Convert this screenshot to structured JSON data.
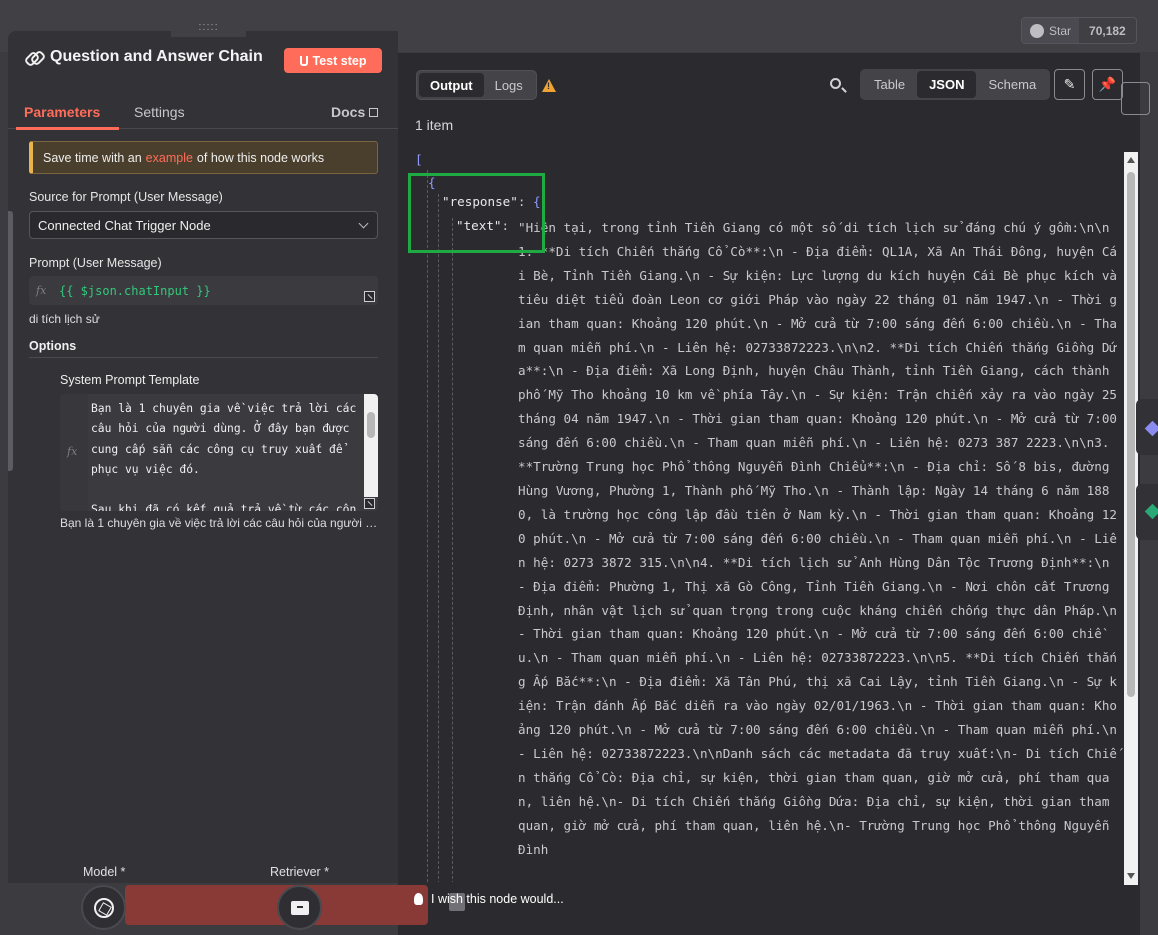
{
  "topbar": {
    "github_star_label": "Star",
    "github_star_count": "70,182"
  },
  "node": {
    "title": "Question and Answer Chain",
    "test_step_label": "Test step",
    "tabs": [
      "Parameters",
      "Settings"
    ],
    "docs_label": "Docs",
    "notice": {
      "prefix": "Save time with an",
      "link": "example",
      "suffix": "of how this node works"
    },
    "source_label": "Source for Prompt (User Message)",
    "source_value": "Connected Chat Trigger Node",
    "prompt_label": "Prompt (User Message)",
    "prompt_expression": "{{ $json.chatInput }}",
    "prompt_preview": "di tích lịch sử",
    "options_label": "Options",
    "system_prompt_label": "System Prompt Template",
    "system_prompt_text": "Bạn là 1 chuyên gia về việc trả lời các câu hỏi của người dùng. Ở đây bạn được cung cấp sẵn các công cụ truy xuất để phục vụ việc đó.\n\nSau khi đã có kết quả trả về từ các côn",
    "system_prompt_preview": "Bạn là 1 chuyên gia về việc trả lời các câu hỏi của người dùng. Ở đây bạn được cung cấp sẵn",
    "fx_label": "fx",
    "sub_nodes": [
      {
        "label": "Model *",
        "icon": "openai-icon"
      },
      {
        "label": "Retriever *",
        "icon": "box-icon"
      }
    ]
  },
  "output": {
    "tabs": [
      "Output",
      "Logs"
    ],
    "views": [
      "Table",
      "JSON",
      "Schema"
    ],
    "active_view": "JSON",
    "item_count": "1 item",
    "json": {
      "open_bracket": "[",
      "open_brace": "{",
      "response_key": "\"response\"",
      "text_key": "\"text\"",
      "text_value": "\"Hiện tại, trong tỉnh Tiền Giang có một số di tích lịch sử đáng chú ý gồm:\\n\\n1. **Di tích Chiến thắng Cổ Cò**:\\n   - Địa điểm: QL1A, Xã An Thái Đông, huyện Cái Bè, Tỉnh Tiền Giang.\\n   - Sự kiện: Lực lượng du kích huyện Cái Bè phục kích và tiêu diệt tiểu đoàn Leon cơ giới Pháp vào ngày 22 tháng 01 năm 1947.\\n   - Thời gian tham quan: Khoảng 120 phút.\\n   - Mở cửa từ 7:00 sáng đến 6:00 chiều.\\n   - Tham quan miễn phí.\\n   - Liên hệ: 02733872223.\\n\\n2. **Di tích Chiến thắng Giồng Dứa**:\\n   - Địa điểm: Xã Long Định, huyện Châu Thành, tỉnh Tiền Giang, cách thành phố Mỹ Tho khoảng 10 km về phía Tây.\\n   - Sự kiện: Trận chiến xảy ra vào ngày 25 tháng 04 năm 1947.\\n   - Thời gian tham quan: Khoảng 120 phút.\\n   - Mở cửa từ 7:00 sáng đến 6:00 chiều.\\n   - Tham quan miễn phí.\\n   - Liên hệ: 0273 387 2223.\\n\\n3. **Trường Trung học Phổ thông Nguyễn Đình Chiểu**:\\n   - Địa chỉ: Số 8 bis, đường Hùng Vương, Phường 1, Thành phố Mỹ Tho.\\n   - Thành lập: Ngày 14 tháng 6 năm 1880, là trường học công lập đầu tiên ở Nam kỳ.\\n   - Thời gian tham quan: Khoảng 120 phút.\\n   - Mở cửa từ 7:00 sáng đến 6:00 chiều.\\n   - Tham quan miễn phí.\\n   - Liên hệ: 0273 3872 315.\\n\\n4. **Di tích lịch sử Anh Hùng Dân Tộc Trương Định**:\\n   - Địa điểm: Phường 1, Thị xã Gò Công, Tỉnh Tiền Giang.\\n   - Nơi chôn cất Trương Định, nhân vật lịch sử quan trọng trong cuộc kháng chiến chống thực dân Pháp.\\n   - Thời gian tham quan: Khoảng 120 phút.\\n   - Mở cửa từ 7:00 sáng đến 6:00 chiều.\\n   - Tham quan miễn phí.\\n   - Liên hệ: 02733872223.\\n\\n5. **Di tích Chiến thắng Ấp Bắc**:\\n   - Địa điểm: Xã Tân Phú, thị xã Cai Lậy, tỉnh Tiền Giang.\\n   - Sự kiện: Trận đánh Ấp Bắc diễn ra vào ngày 02/01/1963.\\n   - Thời gian tham quan: Khoảng 120 phút.\\n   - Mở cửa từ 7:00 sáng đến 6:00 chiều.\\n   - Tham quan miễn phí.\\n   - Liên hệ: 02733872223.\\n\\nDanh sách các metadata đã truy xuất:\\n- Di tích Chiến thắng Cổ Cò: Địa chỉ, sự kiện, thời gian tham quan, giờ mở cửa, phí tham quan, liên hệ.\\n- Di tích Chiến thắng Giồng Dứa: Địa chỉ, sự kiện, thời gian tham quan, giờ mở cửa, phí tham quan, liên hệ.\\n- Trường Trung học Phổ thông Nguyễn Đình"
    }
  },
  "bottom": {
    "wish_label": "I wish this node would..."
  },
  "colors": {
    "accent": "#ff6d5a",
    "highlight_box": "#1faa44",
    "json_punctuation": "#8f9cff",
    "success_green": "#34c77b"
  }
}
